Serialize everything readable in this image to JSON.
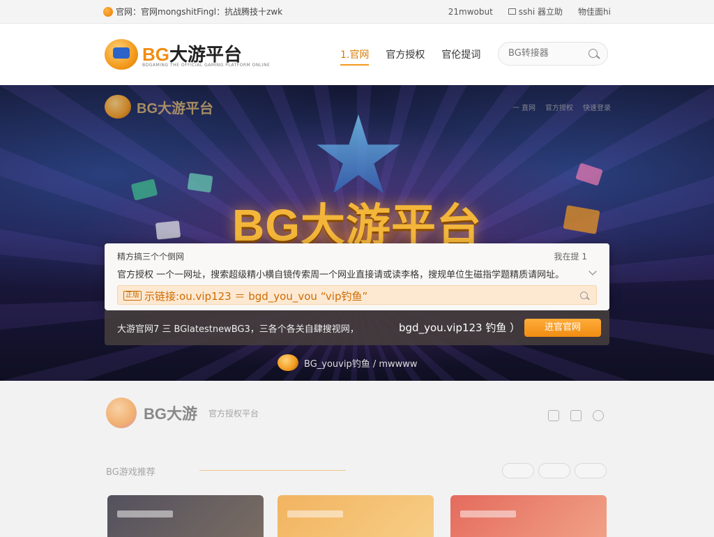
{
  "topbar": {
    "left_text": "官网：官网mongshitFingl：抗战腾技十zwk",
    "right_items": [
      "21mwobut",
      "sshi 器立助",
      "物佳面hi"
    ]
  },
  "header": {
    "logo_bg": "BG",
    "logo_name": "大游平台",
    "logo_sub": "BDGAMING THE OFFICIAL GAMING PLATFORM ONLINE",
    "nav": [
      "1.官网",
      "官方授权",
      "官伦提词"
    ],
    "active_nav_index": 0,
    "search_placeholder": "BG转接器"
  },
  "hero": {
    "logo_text": "BG大游平台",
    "nav": [
      "一 直网",
      "官方授权",
      "快速登录"
    ],
    "title": "BG大游平台"
  },
  "panel": {
    "row1_left": "精方搞三个个倒网",
    "row1_right": "我在提 1",
    "row2": "官方授权 一个一网址，搜索超级精小横自镜传索周一个网业直接请或读李格，搜规单位生磁指学题精质请网址。",
    "field_tag": "正版",
    "field_value": "示链接:ou.vip123 ＝ bgd_you_vou “vip钓鱼”"
  },
  "bar": {
    "text": "大游官网7 三 BGlatestnewBG3，三各个各关自肆搜视网，",
    "url": "bgd_you.vip123 钓鱼 ）",
    "button": "进官官网"
  },
  "hero_footer": {
    "text": "BG_youvip钓鱼 / mwwww"
  },
  "lower": {
    "logo_text": "BG大游",
    "logo_sub": "官方授权平台",
    "section_title": "BG游戏推荐"
  },
  "colors": {
    "accent": "#f39a1c",
    "accent_dark": "#d77d08",
    "hero_bg": "#1e1a46",
    "field_bg": "#fde9d2"
  }
}
